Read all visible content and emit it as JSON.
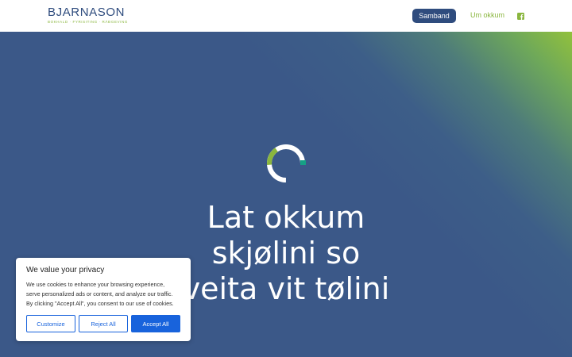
{
  "header": {
    "logo_name": "BJARNASON",
    "logo_tagline": "BOKHALD · FYRISITING · RÁÐGEVING",
    "nav_button_label": "Samband",
    "nav_link_label": "Um okkum",
    "social_icon": "facebook-icon"
  },
  "hero": {
    "spinner_icon": "loading-ring-icon",
    "headline_lines": [
      "Lat okkum",
      "skjølini so",
      "veita vit tølini"
    ]
  },
  "cookie_banner": {
    "title": "We value your privacy",
    "text_lines": [
      "We use cookies to enhance your browsing experience,",
      "serve personalized ads or content, and analyze our traffic.",
      "By clicking \"Accept All\", you consent to our use of cookies."
    ],
    "customize_label": "Customize",
    "reject_label": "Reject All",
    "accept_label": "Accept All"
  },
  "colors": {
    "brand_blue": "#2f4c7e",
    "brand_green": "#8ab63e",
    "hero_bg": "#3b5888",
    "cookie_accent": "#1863dc"
  }
}
